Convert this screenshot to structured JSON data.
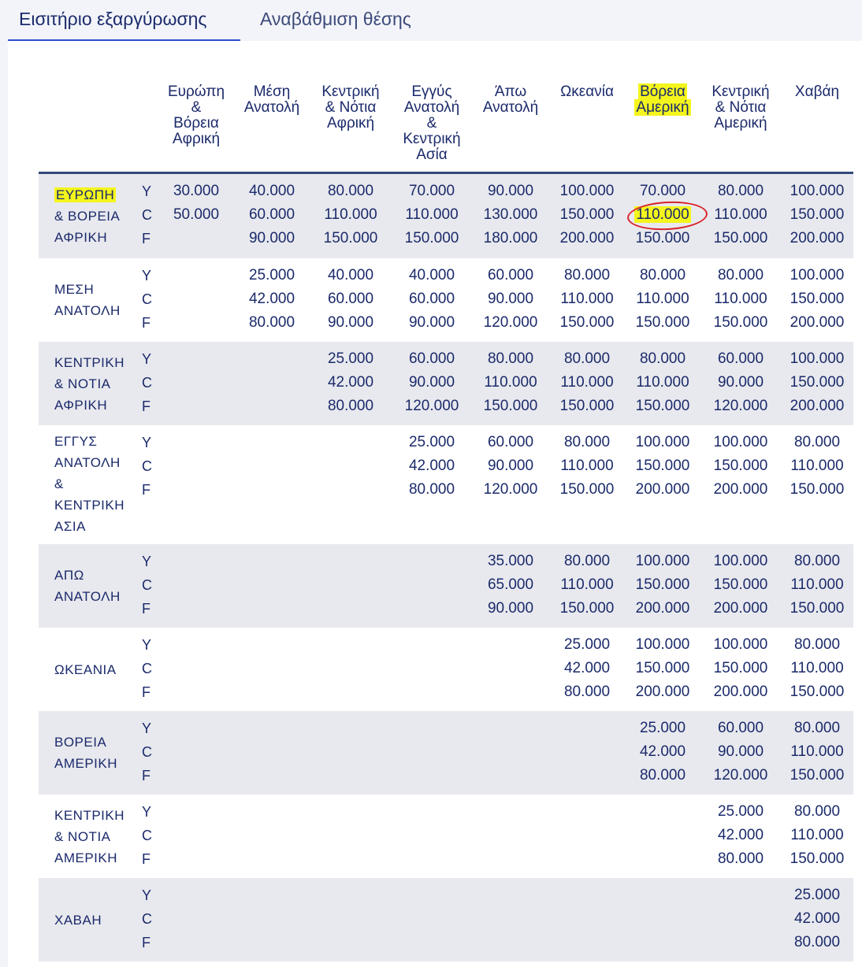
{
  "tabs": {
    "active": "Εισιτήριο εξαργύρωσης",
    "inactive": "Αναβάθμιση θέσης"
  },
  "columns": [
    "Ευρώπη & Βόρεια Αφρική",
    "Μέση Ανατολή",
    "Κεντρική & Νότια Αφρική",
    "Εγγύς Ανατολή & Κεντρική Ασία",
    "Άπω Ανατολή",
    "Ωκεανία",
    "Βόρεια Αμερική",
    "Κεντρική & Νότια Αμερική",
    "Χαβάη"
  ],
  "classes": [
    "Y",
    "C",
    "F"
  ],
  "rows": [
    {
      "label": "ΕΥΡΩΠΗ & ΒΟΡΕΙΑ ΑΦΡΙΚΗ",
      "values": [
        [
          "30.000",
          "50.000",
          ""
        ],
        [
          "40.000",
          "60.000",
          "90.000"
        ],
        [
          "80.000",
          "110.000",
          "150.000"
        ],
        [
          "70.000",
          "110.000",
          "150.000"
        ],
        [
          "90.000",
          "130.000",
          "180.000"
        ],
        [
          "100.000",
          "150.000",
          "200.000"
        ],
        [
          "70.000",
          "110.000",
          "150.000"
        ],
        [
          "80.000",
          "110.000",
          "150.000"
        ],
        [
          "100.000",
          "150.000",
          "200.000"
        ]
      ]
    },
    {
      "label": "ΜΕΣΗ ΑΝΑΤΟΛΗ",
      "values": [
        [
          "",
          "",
          ""
        ],
        [
          "25.000",
          "42.000",
          "80.000"
        ],
        [
          "40.000",
          "60.000",
          "90.000"
        ],
        [
          "40.000",
          "60.000",
          "90.000"
        ],
        [
          "60.000",
          "90.000",
          "120.000"
        ],
        [
          "80.000",
          "110.000",
          "150.000"
        ],
        [
          "80.000",
          "110.000",
          "150.000"
        ],
        [
          "80.000",
          "110.000",
          "150.000"
        ],
        [
          "100.000",
          "150.000",
          "200.000"
        ]
      ]
    },
    {
      "label": "ΚΕΝΤΡΙΚΗ & ΝΟΤΙΑ ΑΦΡΙΚΗ",
      "values": [
        [
          "",
          "",
          ""
        ],
        [
          "",
          "",
          ""
        ],
        [
          "25.000",
          "42.000",
          "80.000"
        ],
        [
          "60.000",
          "90.000",
          "120.000"
        ],
        [
          "80.000",
          "110.000",
          "150.000"
        ],
        [
          "80.000",
          "110.000",
          "150.000"
        ],
        [
          "80.000",
          "110.000",
          "150.000"
        ],
        [
          "60.000",
          "90.000",
          "120.000"
        ],
        [
          "100.000",
          "150.000",
          "200.000"
        ]
      ]
    },
    {
      "label": "ΕΓΓΥΣ ΑΝΑΤΟΛΗ & ΚΕΝΤΡΙΚΗ ΑΣΙΑ",
      "values": [
        [
          "",
          "",
          ""
        ],
        [
          "",
          "",
          ""
        ],
        [
          "",
          "",
          ""
        ],
        [
          "25.000",
          "42.000",
          "80.000"
        ],
        [
          "60.000",
          "90.000",
          "120.000"
        ],
        [
          "80.000",
          "110.000",
          "150.000"
        ],
        [
          "100.000",
          "150.000",
          "200.000"
        ],
        [
          "100.000",
          "150.000",
          "200.000"
        ],
        [
          "80.000",
          "110.000",
          "150.000"
        ]
      ]
    },
    {
      "label": "ΑΠΩ ΑΝΑΤΟΛΗ",
      "values": [
        [
          "",
          "",
          ""
        ],
        [
          "",
          "",
          ""
        ],
        [
          "",
          "",
          ""
        ],
        [
          "",
          "",
          ""
        ],
        [
          "35.000",
          "65.000",
          "90.000"
        ],
        [
          "80.000",
          "110.000",
          "150.000"
        ],
        [
          "100.000",
          "150.000",
          "200.000"
        ],
        [
          "100.000",
          "150.000",
          "200.000"
        ],
        [
          "80.000",
          "110.000",
          "150.000"
        ]
      ]
    },
    {
      "label": "ΩΚΕΑΝΙΑ",
      "values": [
        [
          "",
          "",
          ""
        ],
        [
          "",
          "",
          ""
        ],
        [
          "",
          "",
          ""
        ],
        [
          "",
          "",
          ""
        ],
        [
          "",
          "",
          ""
        ],
        [
          "25.000",
          "42.000",
          "80.000"
        ],
        [
          "100.000",
          "150.000",
          "200.000"
        ],
        [
          "100.000",
          "150.000",
          "200.000"
        ],
        [
          "80.000",
          "110.000",
          "150.000"
        ]
      ]
    },
    {
      "label": "ΒΟΡΕΙΑ ΑΜΕΡΙΚΗ",
      "values": [
        [
          "",
          "",
          ""
        ],
        [
          "",
          "",
          ""
        ],
        [
          "",
          "",
          ""
        ],
        [
          "",
          "",
          ""
        ],
        [
          "",
          "",
          ""
        ],
        [
          "",
          "",
          ""
        ],
        [
          "25.000",
          "42.000",
          "80.000"
        ],
        [
          "60.000",
          "90.000",
          "120.000"
        ],
        [
          "80.000",
          "110.000",
          "150.000"
        ]
      ]
    },
    {
      "label": "ΚΕΝΤΡΙΚΗ & ΝΟΤΙΑ ΑΜΕΡΙΚΗ",
      "values": [
        [
          "",
          "",
          ""
        ],
        [
          "",
          "",
          ""
        ],
        [
          "",
          "",
          ""
        ],
        [
          "",
          "",
          ""
        ],
        [
          "",
          "",
          ""
        ],
        [
          "",
          "",
          ""
        ],
        [
          "",
          "",
          ""
        ],
        [
          "25.000",
          "42.000",
          "80.000"
        ],
        [
          "80.000",
          "110.000",
          "150.000"
        ]
      ]
    },
    {
      "label": "ΧΑΒΑΗ",
      "values": [
        [
          "",
          "",
          ""
        ],
        [
          "",
          "",
          ""
        ],
        [
          "",
          "",
          ""
        ],
        [
          "",
          "",
          ""
        ],
        [
          "",
          "",
          ""
        ],
        [
          "",
          "",
          ""
        ],
        [
          "",
          "",
          ""
        ],
        [
          "",
          "",
          ""
        ],
        [
          "25.000",
          "42.000",
          "80.000"
        ]
      ]
    }
  ],
  "highlight": {
    "color": "#f4f51c",
    "circle_color": "#d8242a"
  }
}
